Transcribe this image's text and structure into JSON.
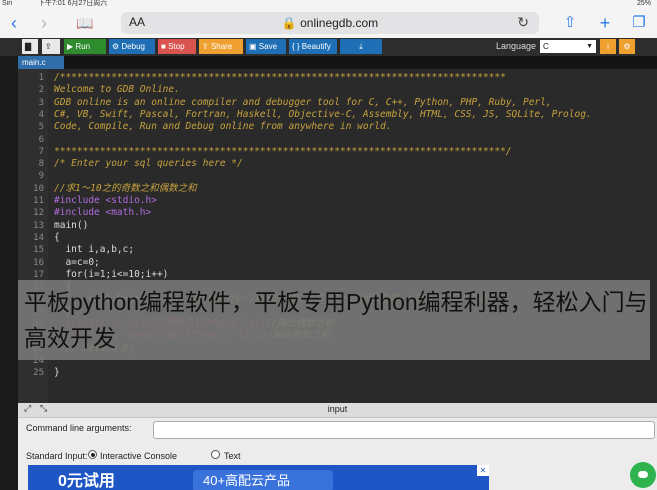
{
  "status_bar": {
    "carrier": "Siri",
    "time": "下午7:01",
    "date": "6月27日周六",
    "battery": "25%"
  },
  "browser": {
    "reader_label": "AA",
    "url": "onlinegdb.com",
    "icons": [
      "chevron-left-icon",
      "chevron-right-icon",
      "book-icon",
      "lock-icon",
      "reload-icon",
      "share-icon",
      "plus-icon",
      "tabs-icon"
    ]
  },
  "toolbar": {
    "new_label": "",
    "upload_label": "",
    "run_label": "▶ Run",
    "debug_label": "Debug",
    "stop_label": "Stop",
    "share_label": "Share",
    "save_label": "Save",
    "beautify_label": "{ } Beautify",
    "download_label": "",
    "language_label": "Language",
    "language_value": "C"
  },
  "colors": {
    "run": "#2e8b2e",
    "debug": "#1e6fb5",
    "stop": "#d9534f",
    "share": "#f0a030",
    "save": "#1e6fb5",
    "beautify": "#1e6fb5",
    "download": "#1e6fb5"
  },
  "editor": {
    "tab_name": "main.c",
    "lines": [
      {
        "n": "1",
        "kind": "cm",
        "text": "/******************************************************************************"
      },
      {
        "n": "2",
        "kind": "cm",
        "text": "Welcome to GDB Online."
      },
      {
        "n": "3",
        "kind": "cm",
        "text": "GDB online is an online compiler and debugger tool for C, C++, Python, PHP, Ruby, Perl,"
      },
      {
        "n": "4",
        "kind": "cm",
        "text": "C#, VB, Swift, Pascal, Fortran, Haskell, Objective-C, Assembly, HTML, CSS, JS, SQLite, Prolog."
      },
      {
        "n": "5",
        "kind": "cm",
        "text": "Code, Compile, Run and Debug online from anywhere in world."
      },
      {
        "n": "6",
        "kind": "cm",
        "text": ""
      },
      {
        "n": "7",
        "kind": "cm",
        "text": "*******************************************************************************/"
      },
      {
        "n": "8",
        "kind": "cm",
        "text": "/* Enter your sql queries here */"
      },
      {
        "n": "9",
        "kind": "tx",
        "text": ""
      },
      {
        "n": "10",
        "kind": "cm",
        "text": "//求1～10之的奇数之和偶数之和"
      },
      {
        "n": "11",
        "kind": "pp",
        "text": "#include <stdio.h>"
      },
      {
        "n": "12",
        "kind": "pp",
        "text": "#include <math.h>"
      },
      {
        "n": "13",
        "kind": "tx",
        "text": "main()"
      },
      {
        "n": "14",
        "kind": "tx",
        "text": "{"
      },
      {
        "n": "15",
        "kind": "tx",
        "text": "  int i,a,b,c;"
      },
      {
        "n": "16",
        "kind": "tx",
        "text": "  a=c=0;"
      },
      {
        "n": "17",
        "kind": "tx",
        "text": "  for(i=1;i<=10;i++)"
      },
      {
        "n": "18",
        "kind": "tx",
        "text": "  {"
      },
      {
        "n": "19",
        "kind": "mix",
        "text": "      a+=i;b=i+1;c+=b;",
        "comment": "//a负责累计1～20间的偶数，b表示1～20间的奇数，c表示1～20间奇数之和"
      },
      {
        "n": "20",
        "kind": "tx",
        "text": "  }"
      },
      {
        "n": "21",
        "kind": "pf",
        "text": "  printf(\"1～10之间的偶数之和为%d\\n\",a);",
        "comment": "//输出偶数之和"
      },
      {
        "n": "22",
        "kind": "pf",
        "text": "  printf(\"1～10间的奇数之和为%d\",c-11);",
        "comment": "//输出奇数之和"
      },
      {
        "n": "23",
        "kind": "cm",
        "text": "  // return 0;"
      },
      {
        "n": "24",
        "kind": "tx",
        "text": ""
      },
      {
        "n": "25",
        "kind": "tx",
        "text": "}"
      }
    ]
  },
  "overlay_caption": "平板python编程软件，平板专用Python编程利器，轻松入门与高效开发",
  "input_panel": {
    "title": "input",
    "cmd_label": "Command line arguments:",
    "cmd_value": "",
    "stdin_label": "Standard Input:",
    "interactive_label": "Interactive Console",
    "text_label": "Text"
  },
  "ad": {
    "left_text": "0元试用",
    "right_text": "40+高配云产品"
  }
}
